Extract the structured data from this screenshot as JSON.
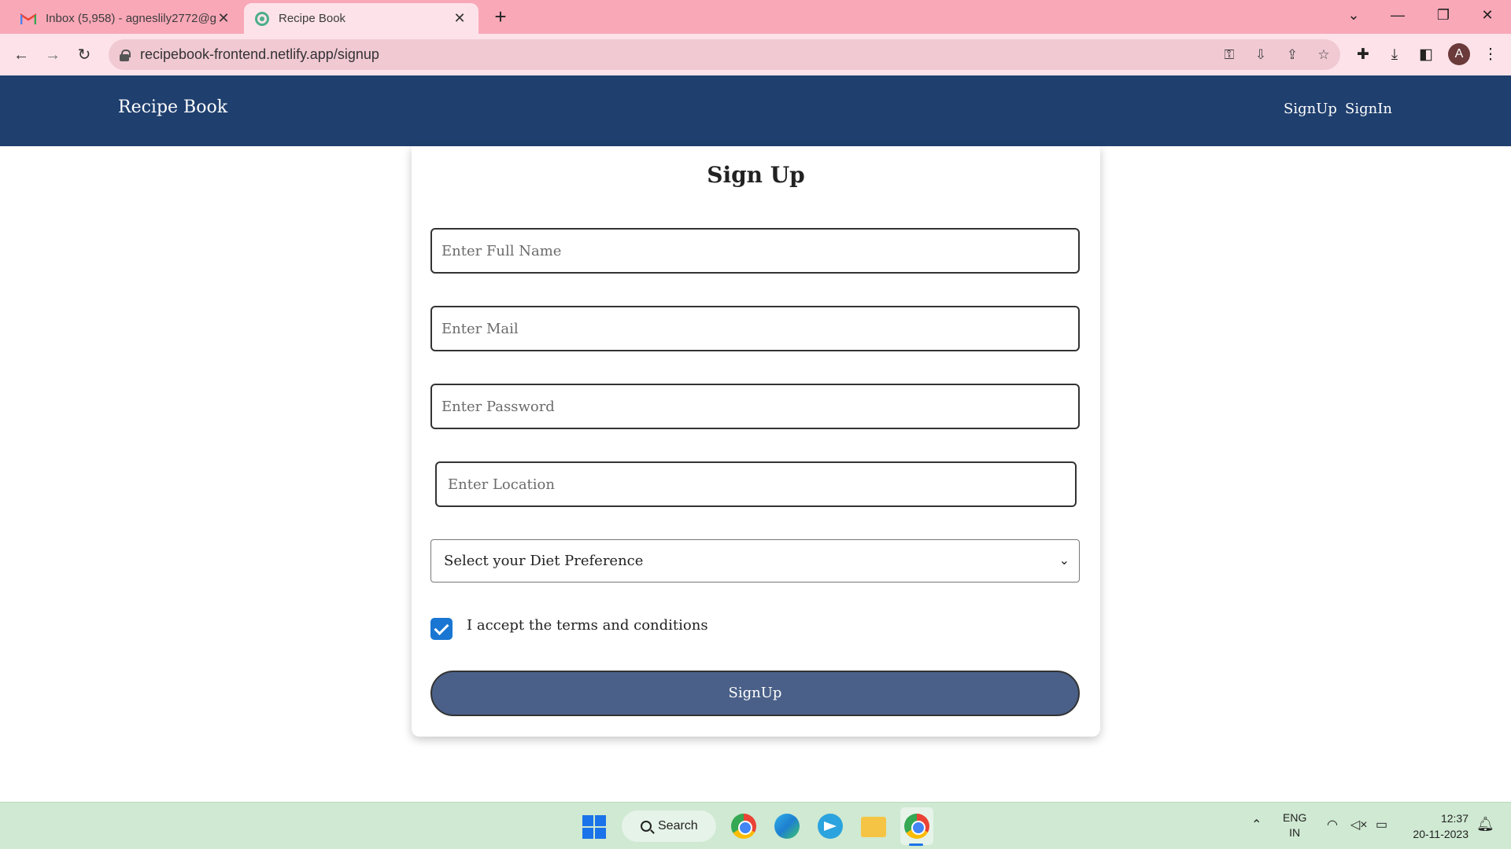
{
  "browser": {
    "tabs": [
      {
        "title": "Inbox (5,958) - agneslily2772@g",
        "active": false,
        "icon": "gmail-icon"
      },
      {
        "title": "Recipe Book",
        "active": true,
        "icon": "recipe-favicon-icon"
      }
    ],
    "url": "recipebook-frontend.netlify.app/signup",
    "profile_initial": "A"
  },
  "app": {
    "brand": "Recipe Book",
    "nav": {
      "signup": "SignUp",
      "signin": "SignIn"
    },
    "colors": {
      "navbar": "#1f3f6e",
      "button": "#4a6088",
      "checkbox": "#1976d2"
    }
  },
  "form": {
    "title": "Sign Up",
    "full_name_placeholder": "Enter Full Name",
    "mail_placeholder": "Enter Mail",
    "password_placeholder": "Enter Password",
    "location_placeholder": "Enter Location",
    "diet_select": "Select your Diet Preference",
    "terms_label": "I accept the terms and conditions",
    "terms_checked": true,
    "submit_label": "SignUp"
  },
  "taskbar": {
    "search_label": "Search",
    "lang_top": "ENG",
    "lang_bottom": "IN",
    "time": "12:37",
    "date": "20-11-2023"
  }
}
